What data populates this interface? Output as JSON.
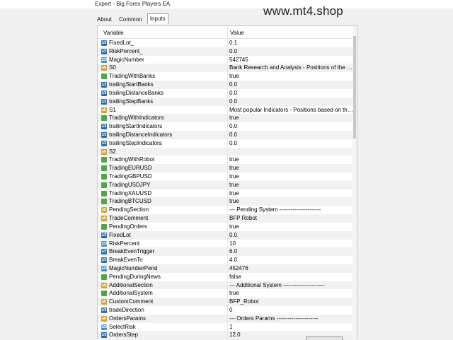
{
  "window": {
    "title": "Expert - Big Forex Players EA"
  },
  "watermark": "www.mt4.shop",
  "tabs": [
    {
      "label": "About"
    },
    {
      "label": "Common"
    },
    {
      "label": "Inputs",
      "active": true
    }
  ],
  "table": {
    "col_variable": "Variable",
    "col_value": "Value",
    "rows": [
      {
        "name": "FixedLot_",
        "value": "0.1",
        "icon": "dbl-icon"
      },
      {
        "name": "RiskPercent_",
        "value": "0.0",
        "icon": "dbl-icon"
      },
      {
        "name": "MagicNumber",
        "value": "542745",
        "icon": "int-icon"
      },
      {
        "name": "S0",
        "value": "Bank Research and Analysis - Positions of the bigg...",
        "icon": "string-icon"
      },
      {
        "name": "TradingWithBanks",
        "value": "true",
        "icon": "bool-icon"
      },
      {
        "name": "trailingStartBanks",
        "value": "0.0",
        "icon": "dbl-icon"
      },
      {
        "name": "trailingDistanceBanks",
        "value": "0.0",
        "icon": "dbl-icon"
      },
      {
        "name": "trailingStepBanks",
        "value": "0.0",
        "icon": "dbl-icon"
      },
      {
        "name": "S1",
        "value": "Most popular Indicators - Positions based on the p...",
        "icon": "string-icon"
      },
      {
        "name": "TradingWithIndicators",
        "value": "true",
        "icon": "bool-icon"
      },
      {
        "name": "trailingStartIndicators",
        "value": "0.0",
        "icon": "dbl-icon"
      },
      {
        "name": "trailingDistanceIndicators",
        "value": "0.0",
        "icon": "dbl-icon"
      },
      {
        "name": "trailingStepIndicators",
        "value": "0.0",
        "icon": "dbl-icon"
      },
      {
        "name": "S2",
        "value": "",
        "icon": "string-icon"
      },
      {
        "name": "TradingWithRobot",
        "value": "true",
        "icon": "bool-icon"
      },
      {
        "name": "TradingEURUSD",
        "value": "true",
        "icon": "bool-icon"
      },
      {
        "name": "TradingGBPUSD",
        "value": "true",
        "icon": "bool-icon"
      },
      {
        "name": "TradingUSDJPY",
        "value": "true",
        "icon": "bool-icon"
      },
      {
        "name": "TradingXAUUSD",
        "value": "true",
        "icon": "bool-icon"
      },
      {
        "name": "TradingBTCUSD",
        "value": "true",
        "icon": "bool-icon"
      },
      {
        "name": "PendingSection",
        "value": "--- Pending System ----------------------",
        "icon": "string-icon"
      },
      {
        "name": "TradeComment",
        "value": "BFP Robot",
        "icon": "string-icon"
      },
      {
        "name": "PendingOrders",
        "value": "true",
        "icon": "bool-icon"
      },
      {
        "name": "FixedLot",
        "value": "0.0",
        "icon": "dbl-icon"
      },
      {
        "name": "RiskPercent",
        "value": "10",
        "icon": "int-icon"
      },
      {
        "name": "BreakEvenTrigger",
        "value": "6.0",
        "icon": "dbl-icon"
      },
      {
        "name": "BreakEvenTo",
        "value": "4.0",
        "icon": "dbl-icon"
      },
      {
        "name": "MagicNumberPend",
        "value": "452476",
        "icon": "int-icon"
      },
      {
        "name": "PendingDuringNews",
        "value": "false",
        "icon": "bool-icon"
      },
      {
        "name": "AdditionalSection",
        "value": "--- Additional System ----------------------",
        "icon": "string-icon"
      },
      {
        "name": "AdditionalSystem",
        "value": "true",
        "icon": "bool-icon"
      },
      {
        "name": "CustomComment",
        "value": "BFP_Robot",
        "icon": "string-icon"
      },
      {
        "name": "tradeDirection",
        "value": "0",
        "icon": "dbl-icon"
      },
      {
        "name": "OrdersParams",
        "value": "--- Orders Params ----------------------",
        "icon": "string-icon"
      },
      {
        "name": "SelectRisk",
        "value": "1",
        "icon": "int-icon"
      },
      {
        "name": "OrdersStep",
        "value": "12.0",
        "icon": "dbl-icon"
      }
    ]
  }
}
